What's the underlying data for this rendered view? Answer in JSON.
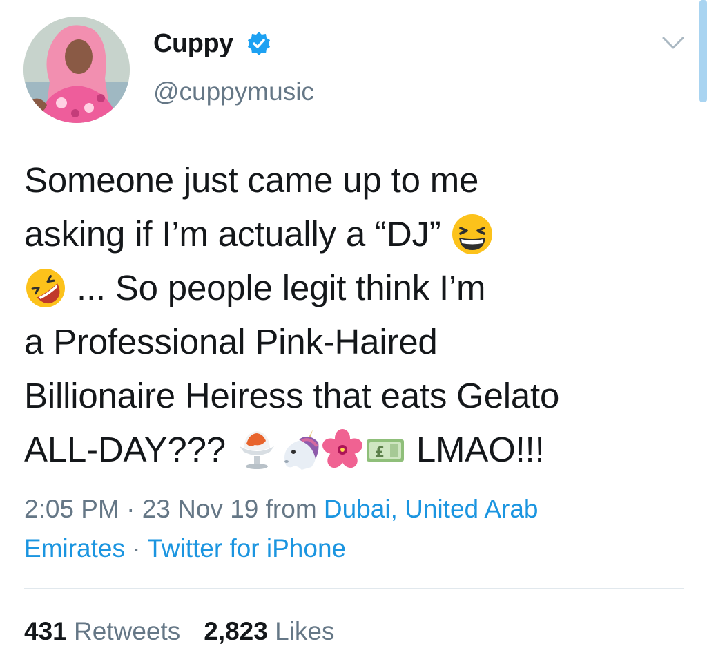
{
  "tweet": {
    "author": {
      "display_name": "Cuppy",
      "handle": "@cuppymusic",
      "verified_icon": "verified-badge-icon",
      "avatar": "profile-photo"
    },
    "menu_icon": "chevron-down-icon",
    "text_lines": [
      [
        "Someone just came up to me"
      ],
      [
        "asking if I’m actually a “DJ” "
      ],
      [
        " ... So people legit think I’m"
      ],
      [
        "a Professional Pink-Haired"
      ],
      [
        "Billionaire Heiress that eats Gelato"
      ],
      [
        "ALL-DAY??? ",
        " LMAO!!!"
      ]
    ],
    "emojis": [
      "grinning-squinting-face",
      "rolling-on-floor-laughing",
      "shaved-ice",
      "unicorn",
      "cherry-blossom",
      "pound-banknote"
    ],
    "meta": {
      "time": "2:05 PM",
      "separator": " · ",
      "date": "23 Nov 19",
      "from_label": " from ",
      "location_line1": "Dubai, United Arab",
      "location_line2": "Emirates",
      "client": "Twitter for iPhone"
    },
    "stats": {
      "retweets_count": "431",
      "retweets_label": "Retweets",
      "likes_count": "2,823",
      "likes_label": "Likes"
    },
    "colors": {
      "link": "#1b95e0",
      "secondary_text": "#657786",
      "primary_text": "#14171a",
      "verified": "#1da1f2",
      "divider": "#e1e8ed"
    }
  }
}
